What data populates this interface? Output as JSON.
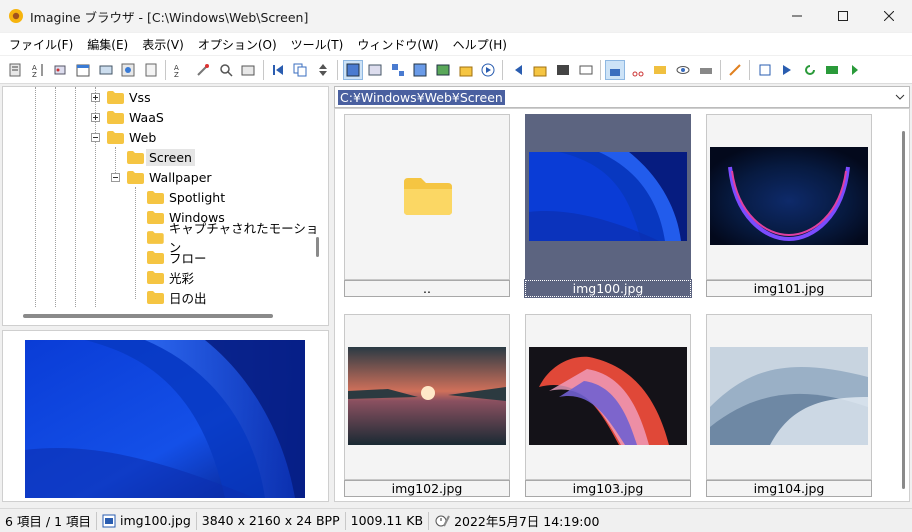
{
  "window": {
    "title": "Imagine ブラウザ - [C:\\Windows\\Web\\Screen]"
  },
  "menu": [
    "ファイル(F)",
    "編集(E)",
    "表示(V)",
    "オプション(O)",
    "ツール(T)",
    "ウィンドウ(W)",
    "ヘルプ(H)"
  ],
  "tree": {
    "items": [
      {
        "label": "Vss",
        "state": "collapsed"
      },
      {
        "label": "WaaS",
        "state": "collapsed"
      },
      {
        "label": "Web",
        "state": "expanded"
      },
      {
        "label": "Screen",
        "state": "selected"
      },
      {
        "label": "Wallpaper",
        "state": "expanded"
      },
      {
        "label": "Spotlight"
      },
      {
        "label": "Windows"
      },
      {
        "label": "キャプチャされたモーション"
      },
      {
        "label": "フロー"
      },
      {
        "label": "光彩"
      },
      {
        "label": "日の出"
      }
    ]
  },
  "path": {
    "value": "C:¥Windows¥Web¥Screen"
  },
  "thumbnails": [
    {
      "label": "..",
      "kind": "folder"
    },
    {
      "label": "img100.jpg",
      "kind": "image",
      "selected": true
    },
    {
      "label": "img101.jpg",
      "kind": "image"
    },
    {
      "label": "img102.jpg",
      "kind": "image"
    },
    {
      "label": "img103.jpg",
      "kind": "image"
    },
    {
      "label": "img104.jpg",
      "kind": "image"
    }
  ],
  "status": {
    "count": "6 項目 / 1 項目",
    "file": "img100.jpg",
    "dimensions": "3840 x 2160 x 24 BPP",
    "size": "1009.11 KB",
    "date": "2022年5月7日  14:19:00"
  },
  "colors": {
    "selection": "#5c6480",
    "path_highlight": "#4a60a0",
    "folder": "#f5c542"
  }
}
